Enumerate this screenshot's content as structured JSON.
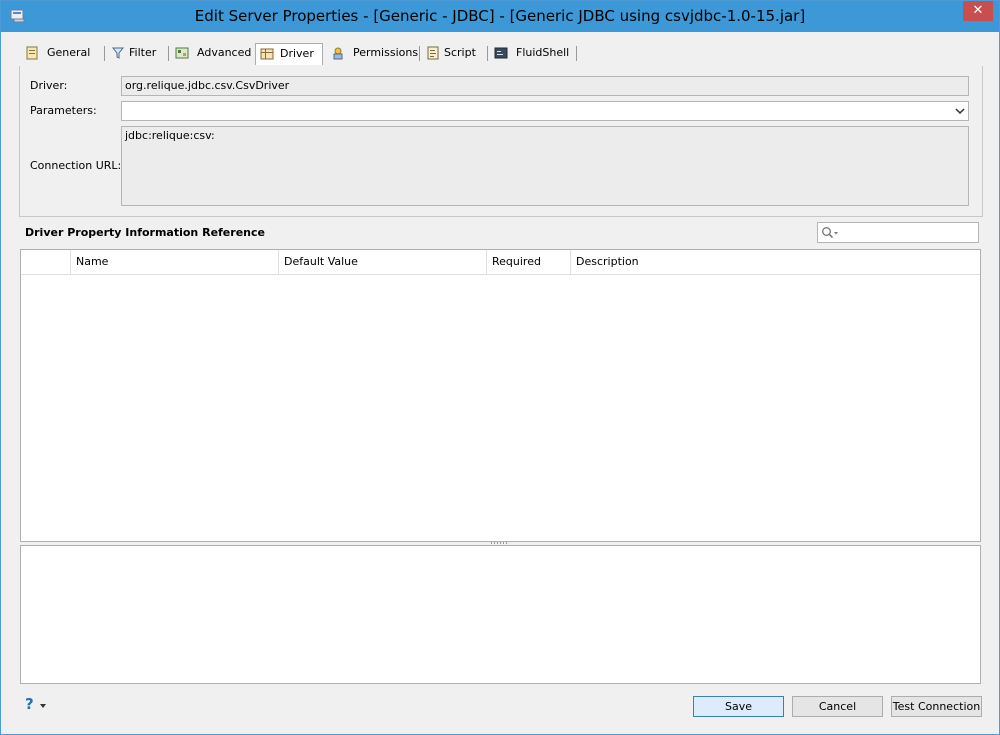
{
  "window": {
    "title": "Edit Server Properties - [Generic - JDBC] - [Generic JDBC using csvjdbc-1.0-15.jar]",
    "close_label": "✕"
  },
  "tabs": [
    {
      "label": "General",
      "icon": "properties-icon"
    },
    {
      "label": "Filter",
      "icon": "filter-icon"
    },
    {
      "label": "Advanced",
      "icon": "advanced-icon"
    },
    {
      "label": "Driver",
      "icon": "driver-icon",
      "active": true
    },
    {
      "label": "Permissions",
      "icon": "permissions-icon"
    },
    {
      "label": "Script",
      "icon": "script-icon"
    },
    {
      "label": "FluidShell",
      "icon": "shell-icon"
    }
  ],
  "form": {
    "driver_label": "Driver:",
    "driver_value": "org.relique.jdbc.csv.CsvDriver",
    "parameters_label": "Parameters:",
    "parameters_value": "",
    "url_label": "Connection URL:",
    "url_value": "jdbc:relique:csv:"
  },
  "reference": {
    "title": "Driver Property Information Reference",
    "search_value": "",
    "columns": [
      "",
      "Name",
      "Default Value",
      "Required",
      "Description"
    ],
    "rows": []
  },
  "footer": {
    "help_label": "?",
    "save_label": "Save",
    "cancel_label": "Cancel",
    "test_label": "Test Connection"
  },
  "colors": {
    "titlebar": "#3c98d6",
    "close": "#c74f4f",
    "default_button": "#dcecfc"
  }
}
